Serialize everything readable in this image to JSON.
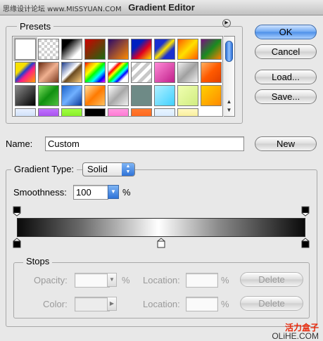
{
  "window": {
    "title": "Gradient Editor",
    "watermark_top": "思缘设计论坛 www.MISSYUAN.COM",
    "watermark_bottom_cn": "活力盒子",
    "watermark_bottom_en": "OLiHE.COM"
  },
  "presets": {
    "label": "Presets",
    "swatches": [
      {
        "icon": "white-swatch",
        "bg": "#ffffff"
      },
      {
        "icon": "transparent-swatch",
        "bg": "checker"
      },
      {
        "icon": "black-white-swatch",
        "bg": "linear-gradient(135deg,#000 25%,#fff 75%)"
      },
      {
        "icon": "red-green-swatch",
        "bg": "linear-gradient(135deg,#d00000,#1a6b10)"
      },
      {
        "icon": "violet-orange-swatch",
        "bg": "linear-gradient(135deg,#2a0a6a,#ff8a00)"
      },
      {
        "icon": "blue-red-yellow-swatch",
        "bg": "linear-gradient(135deg,#0020c0 30%,#e00020 60%,#ffe000)"
      },
      {
        "icon": "blue-yellow-blue-swatch",
        "bg": "linear-gradient(135deg,#1a30d0 30%,#ffe400 50%,#1a30d0 70%)"
      },
      {
        "icon": "orange-yellow-orange-swatch",
        "bg": "linear-gradient(135deg,#ff5a00,#ffe000,#ff5a00)"
      },
      {
        "icon": "violet-green-orange-swatch",
        "bg": "linear-gradient(135deg,#7a1080,#1a8a20,#ff8000)"
      },
      {
        "icon": "yellow-violet-stripe-swatch",
        "bg": "linear-gradient(135deg,#f8e000 30%,#2040d0 45%,#ff2080 60%,#ffa000)"
      },
      {
        "icon": "copper-swatch",
        "bg": "linear-gradient(135deg,#6a2a10,#f0b090,#7a3a20)"
      },
      {
        "icon": "chrome-swatch",
        "bg": "linear-gradient(135deg,#1a3a8a,#ffffff 45%,#6a4a20 55%,#ffd080)"
      },
      {
        "icon": "spectrum-swatch",
        "bg": "linear-gradient(135deg,red,orange,yellow,lime,cyan,blue,magenta)"
      },
      {
        "icon": "transparent-rainbow-swatch",
        "bg": "linear-gradient(135deg,#fff 20%,red,yellow,lime,cyan,blue,#fff 80%)"
      },
      {
        "icon": "transparent-stripes-swatch",
        "bg": "repeating-linear-gradient(135deg,#ffffff 0 5px,#c8c8c8 5px 10px)"
      },
      {
        "icon": "magenta-swatch",
        "bg": "linear-gradient(135deg,#ff8ad8,#c0208a)"
      },
      {
        "icon": "silver-swatch",
        "bg": "linear-gradient(135deg,#f0f0f0,#a0a0a0,#f0f0f0)"
      },
      {
        "icon": "orange-red-swatch",
        "bg": "linear-gradient(135deg,#ffb060,#ff5a00,#e04000)"
      },
      {
        "icon": "dark-gray-swatch",
        "bg": "linear-gradient(135deg,#8a8a8a,#000000)"
      },
      {
        "icon": "green-swatch",
        "bg": "linear-gradient(135deg,#80e060,#109010,#50c040)"
      },
      {
        "icon": "blue-swatch",
        "bg": "linear-gradient(135deg,#1a60c8,#70b0ff,#0a3a9a)"
      },
      {
        "icon": "orange-swatch",
        "bg": "linear-gradient(135deg,#ffe0a0,#ff7a00,#ffc060)"
      },
      {
        "icon": "gray-white-swatch",
        "bg": "linear-gradient(135deg,#ffffff,#a8a8a8,#f0f0f0)"
      },
      {
        "icon": "teal-gray-swatch",
        "bg": "#6e8a86"
      },
      {
        "icon": "light-blue-swatch",
        "bg": "linear-gradient(135deg,#b0f0ff,#40d0ff)"
      },
      {
        "icon": "light-green-swatch",
        "bg": "linear-gradient(135deg,#f0ffb0,#d0ec80)"
      },
      {
        "icon": "yellow-orange-swatch",
        "bg": "linear-gradient(135deg,#ffd000,#ff8a00)"
      },
      {
        "icon": "sky-swatch",
        "bg": "linear-gradient(#e8f0ff,#a8c8f0)"
      },
      {
        "icon": "purple-swatch",
        "bg": "linear-gradient(#c070ff,#8020d0)"
      },
      {
        "icon": "lime-swatch",
        "bg": "linear-gradient(#a0ff40,#60d000)"
      },
      {
        "icon": "black-swatch",
        "bg": "#000000"
      },
      {
        "icon": "pink-swatch",
        "bg": "linear-gradient(#ff9ae0,#ff40c0)"
      },
      {
        "icon": "orange-red-bottom-swatch",
        "bg": "linear-gradient(#ff7a30,#ff4a00)"
      },
      {
        "icon": "pale-blue-swatch",
        "bg": "linear-gradient(#e8f4ff,#c0dcff)"
      },
      {
        "icon": "pale-yellow-swatch",
        "bg": "linear-gradient(#fff8c0,#f0e060)"
      }
    ]
  },
  "buttons": {
    "ok": "OK",
    "cancel": "Cancel",
    "load": "Load...",
    "save": "Save...",
    "new": "New"
  },
  "name_field": {
    "label": "Name:",
    "value": "Custom"
  },
  "gradient_type": {
    "label": "Gradient Type:",
    "value": "Solid"
  },
  "smoothness": {
    "label": "Smoothness:",
    "value": "100",
    "unit": "%"
  },
  "gradient": {
    "css": "linear-gradient(to right,#0a0a0a 0%,#6a6a6a 22%,#ffffff 49%,#8a8a8a 70%,#0a0a0a 100%)",
    "color_stops": [
      0,
      50,
      100
    ],
    "opacity_stops": [
      0,
      100
    ]
  },
  "stops": {
    "label": "Stops",
    "opacity_label": "Opacity:",
    "opacity_unit": "%",
    "color_label": "Color:",
    "location_label_1": "Location:",
    "location_unit_1": "%",
    "location_label_2": "Location:",
    "location_unit_2": "%",
    "delete_1": "Delete",
    "delete_2": "Delete"
  }
}
